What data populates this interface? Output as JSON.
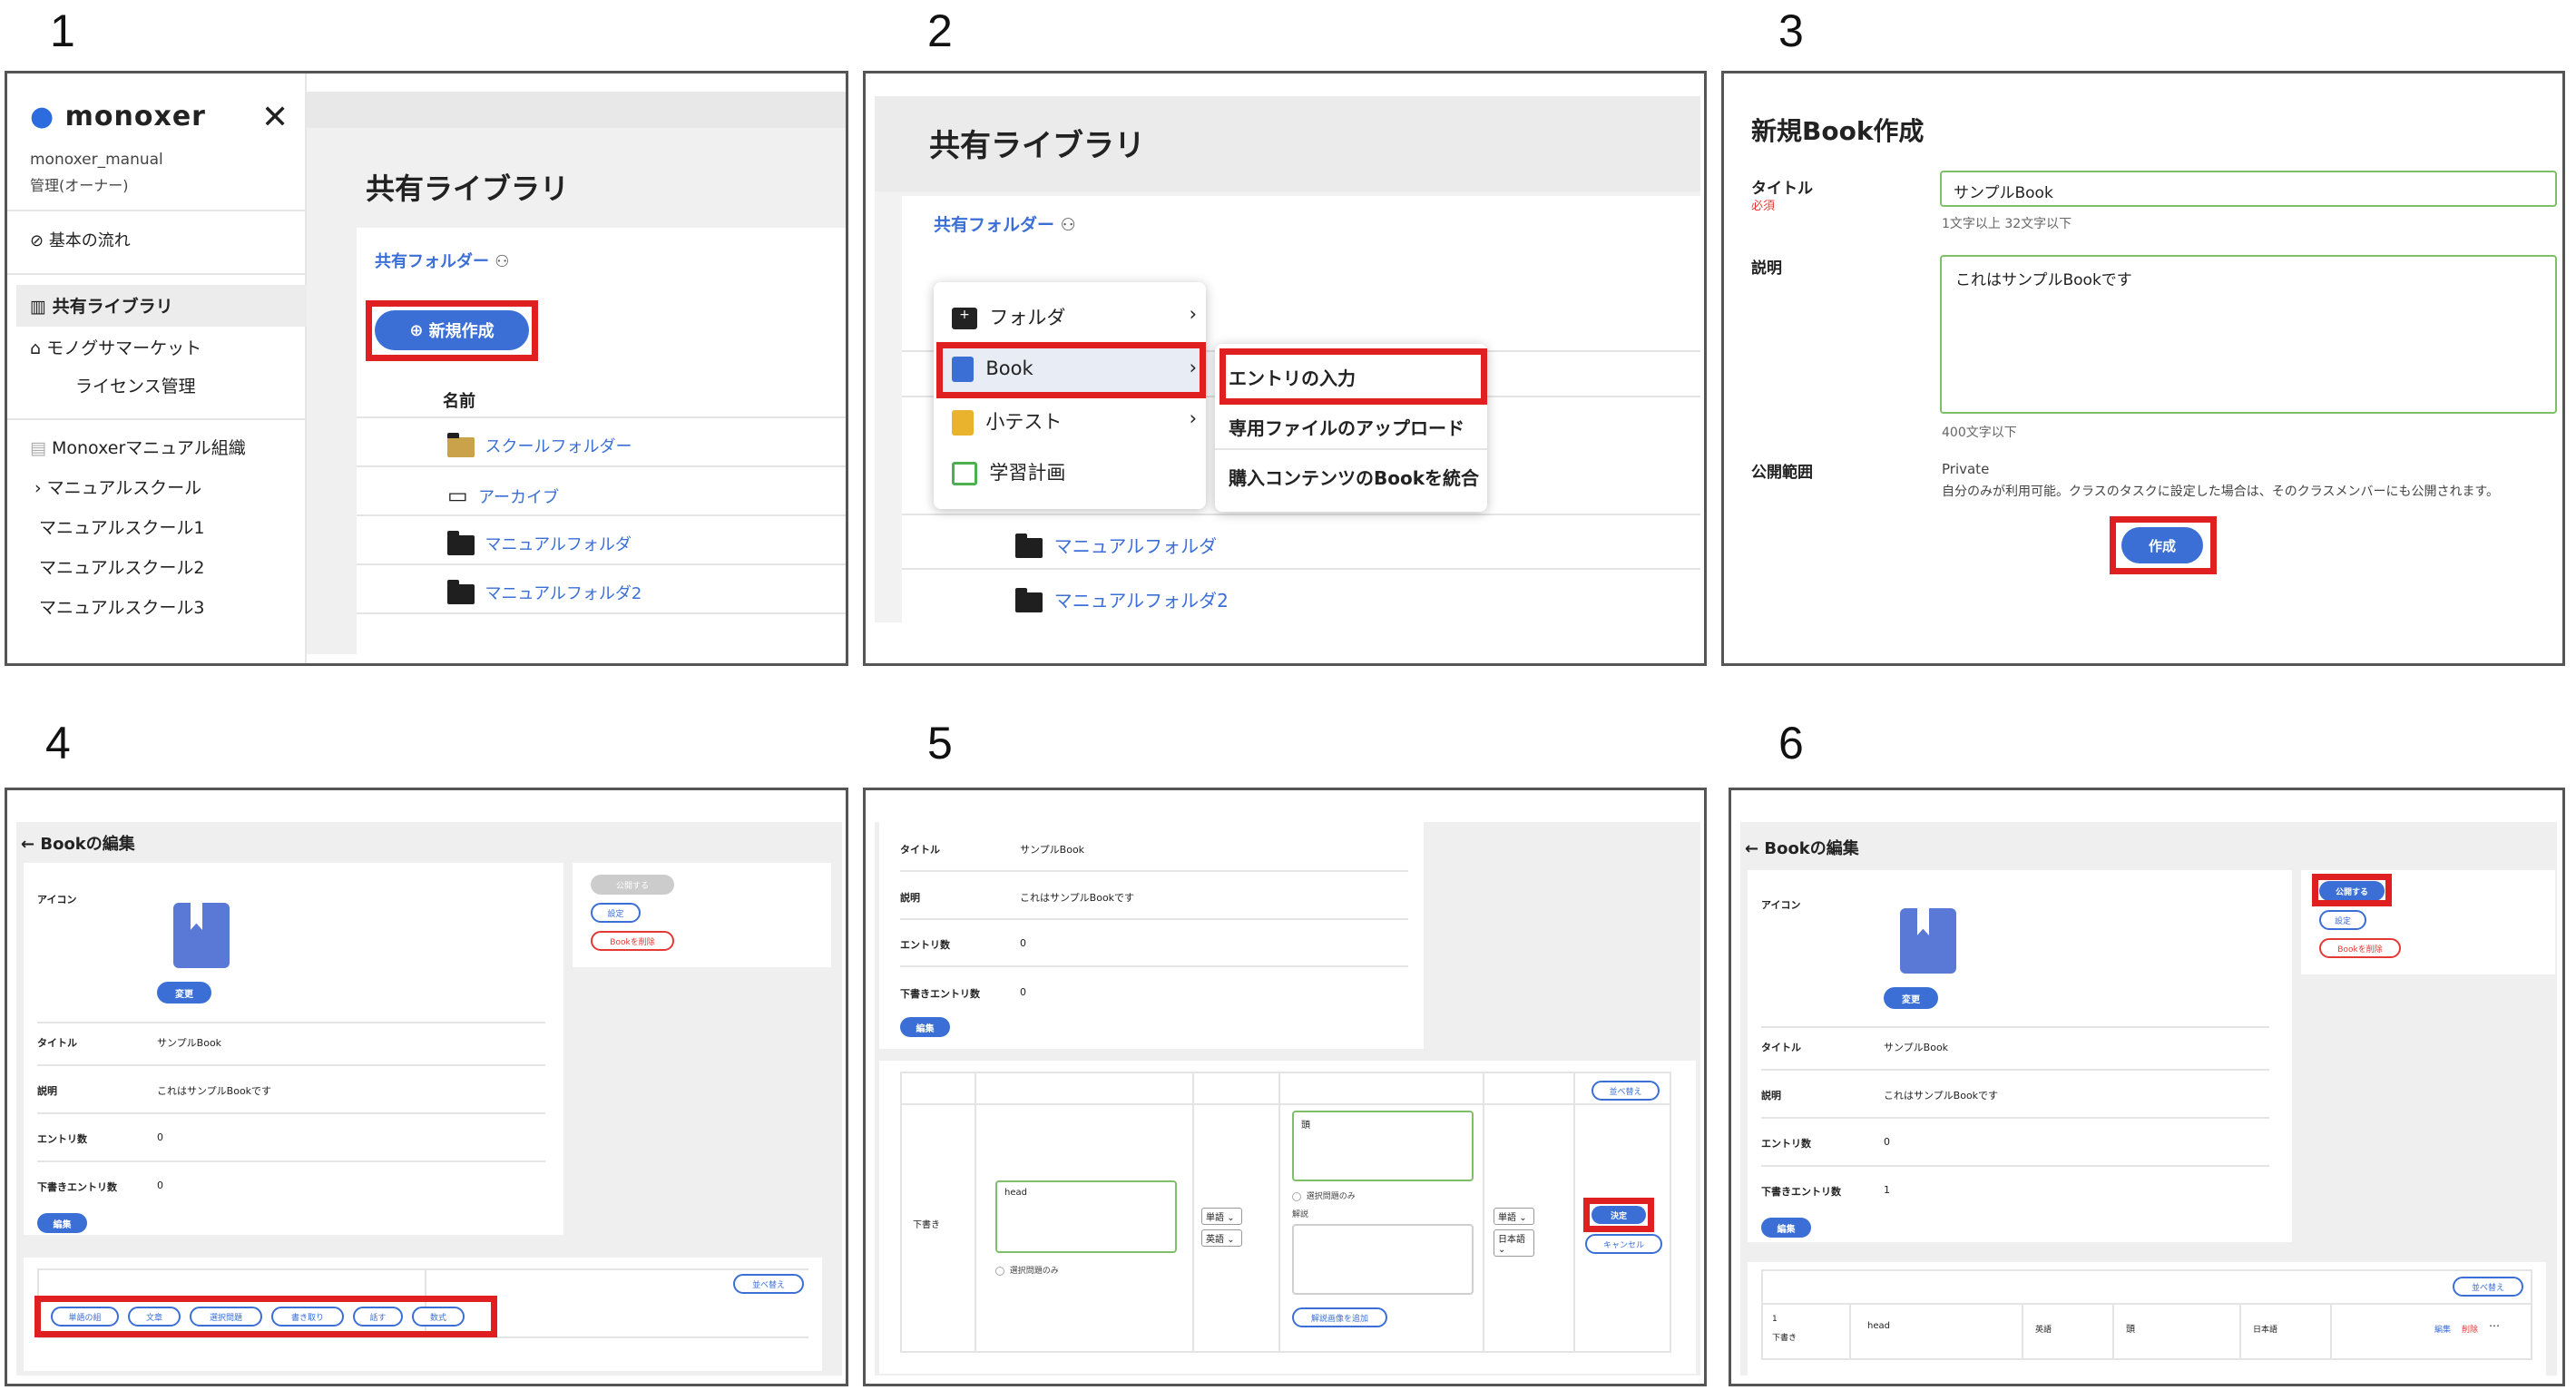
{
  "step_numbers": [
    "1",
    "2",
    "3",
    "4",
    "5",
    "6"
  ],
  "p1": {
    "brand": "monoxer",
    "user_name": "monoxer_manual",
    "user_role": "管理(オーナー)",
    "nav": [
      "基本の流れ",
      "共有ライブラリ",
      "モノグサマーケット",
      "ライセンス管理",
      "Monoxerマニュアル組織",
      "マニュアルスクール",
      "マニュアルスクール1",
      "マニュアルスクール2",
      "マニュアルスクール3"
    ],
    "title": "共有ライブラリ",
    "shared_folder": "共有フォルダー",
    "new_button": "新規作成",
    "col_name": "名前",
    "rows": [
      "スクールフォルダー",
      "アーカイブ",
      "マニュアルフォルダ",
      "マニュアルフォルダ2"
    ]
  },
  "p2": {
    "title": "共有ライブラリ",
    "shared_folder": "共有フォルダー",
    "menu": [
      "フォルダ",
      "Book",
      "小テスト",
      "学習計画"
    ],
    "submenu": [
      "エントリの入力",
      "専用ファイルのアップロード",
      "購入コンテンツのBookを統合"
    ],
    "rows": [
      "マニュアルフォルダ",
      "マニュアルフォルダ2"
    ]
  },
  "p3": {
    "heading": "新規Book作成",
    "title_label": "タイトル",
    "required": "必須",
    "title_value": "サンプルBook",
    "title_hint": "1文字以上 32文字以下",
    "desc_label": "説明",
    "desc_value": "これはサンプルBookです",
    "desc_hint": "400文字以下",
    "scope_label": "公開範囲",
    "scope_value": "Private",
    "scope_note": "自分のみが利用可能。クラスのタスクに設定した場合は、そのクラスメンバーにも公開されます。",
    "create_button": "作成"
  },
  "p4": {
    "heading": "Bookの編集",
    "icon_label": "アイコン",
    "change_button": "変更",
    "publish_button": "公開する",
    "settings_button": "設定",
    "delete_button": "Bookを削除",
    "fields": [
      {
        "label": "タイトル",
        "value": "サンプルBook"
      },
      {
        "label": "説明",
        "value": "これはサンプルBookです"
      },
      {
        "label": "エントリ数",
        "value": "0"
      },
      {
        "label": "下書きエントリ数",
        "value": "0"
      }
    ],
    "edit_button": "編集",
    "sort_button": "並べ替え",
    "type_buttons": [
      "単語の組",
      "文章",
      "選択問題",
      "書き取り",
      "話す",
      "数式"
    ]
  },
  "p5": {
    "fields": [
      {
        "label": "タイトル",
        "value": "サンプルBook"
      },
      {
        "label": "説明",
        "value": "これはサンプルBookです"
      },
      {
        "label": "エントリ数",
        "value": "0"
      },
      {
        "label": "下書きエントリ数",
        "value": "0"
      }
    ],
    "edit_button": "編集",
    "sort_button": "並べ替え",
    "draft_label": "下書き",
    "head_value": "head",
    "select_only_1": "選択問題のみ",
    "answer_value": "頭",
    "select_only_2": "選択問題のみ",
    "explanation_label": "解説",
    "sel_word": "単語",
    "sel_en": "英語",
    "sel_word2": "単語",
    "sel_ja": "日本語",
    "add_image_button": "解説画像を追加",
    "decide_button": "決定",
    "cancel_button": "キャンセル"
  },
  "p6": {
    "heading": "Bookの編集",
    "icon_label": "アイコン",
    "change_button": "変更",
    "publish_button": "公開する",
    "settings_button": "設定",
    "delete_button": "Bookを削除",
    "fields": [
      {
        "label": "タイトル",
        "value": "サンプルBook"
      },
      {
        "label": "説明",
        "value": "これはサンプルBookです"
      },
      {
        "label": "エントリ数",
        "value": "0"
      },
      {
        "label": "下書きエントリ数",
        "value": "1"
      }
    ],
    "edit_button": "編集",
    "sort_button": "並べ替え",
    "row": {
      "num": "1",
      "status": "下書き",
      "q": "head",
      "q_lang": "英語",
      "a": "頭",
      "a_lang": "日本語",
      "edit": "編集",
      "del": "削除",
      "more": "⋯"
    }
  }
}
